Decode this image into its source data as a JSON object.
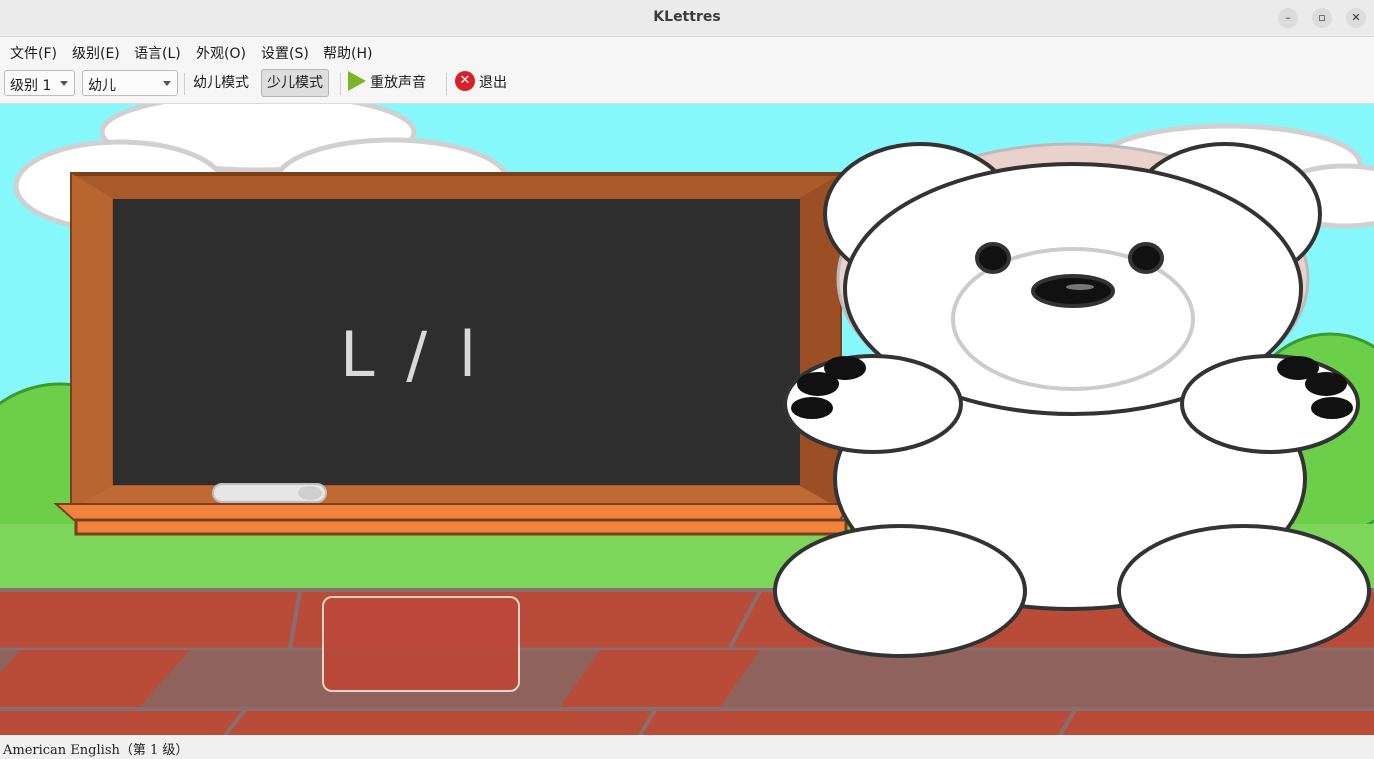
{
  "window": {
    "title": "KLettres",
    "controls": [
      "minimize",
      "maximize",
      "close"
    ]
  },
  "menubar": {
    "items": [
      "文件(F)",
      "级别(E)",
      "语言(L)",
      "外观(O)",
      "设置(S)",
      "帮助(H)"
    ]
  },
  "toolbar": {
    "level_select": "级别 1",
    "mode_select": "幼儿",
    "kid_mode": "幼儿模式",
    "grownup_mode": "少儿模式",
    "replay": "重放声音",
    "quit": "退出",
    "active_mode": "少儿模式"
  },
  "board": {
    "letter": "L / l"
  },
  "answer": {
    "value": ""
  },
  "status": {
    "text": "American English（第 1 级）"
  },
  "colors": {
    "sky": "#86f8fb",
    "board": "#2e2e2e",
    "frame": "#a85a2b",
    "wall": "#b94c38",
    "play_icon": "#7ab526",
    "quit_icon": "#d8202a"
  }
}
